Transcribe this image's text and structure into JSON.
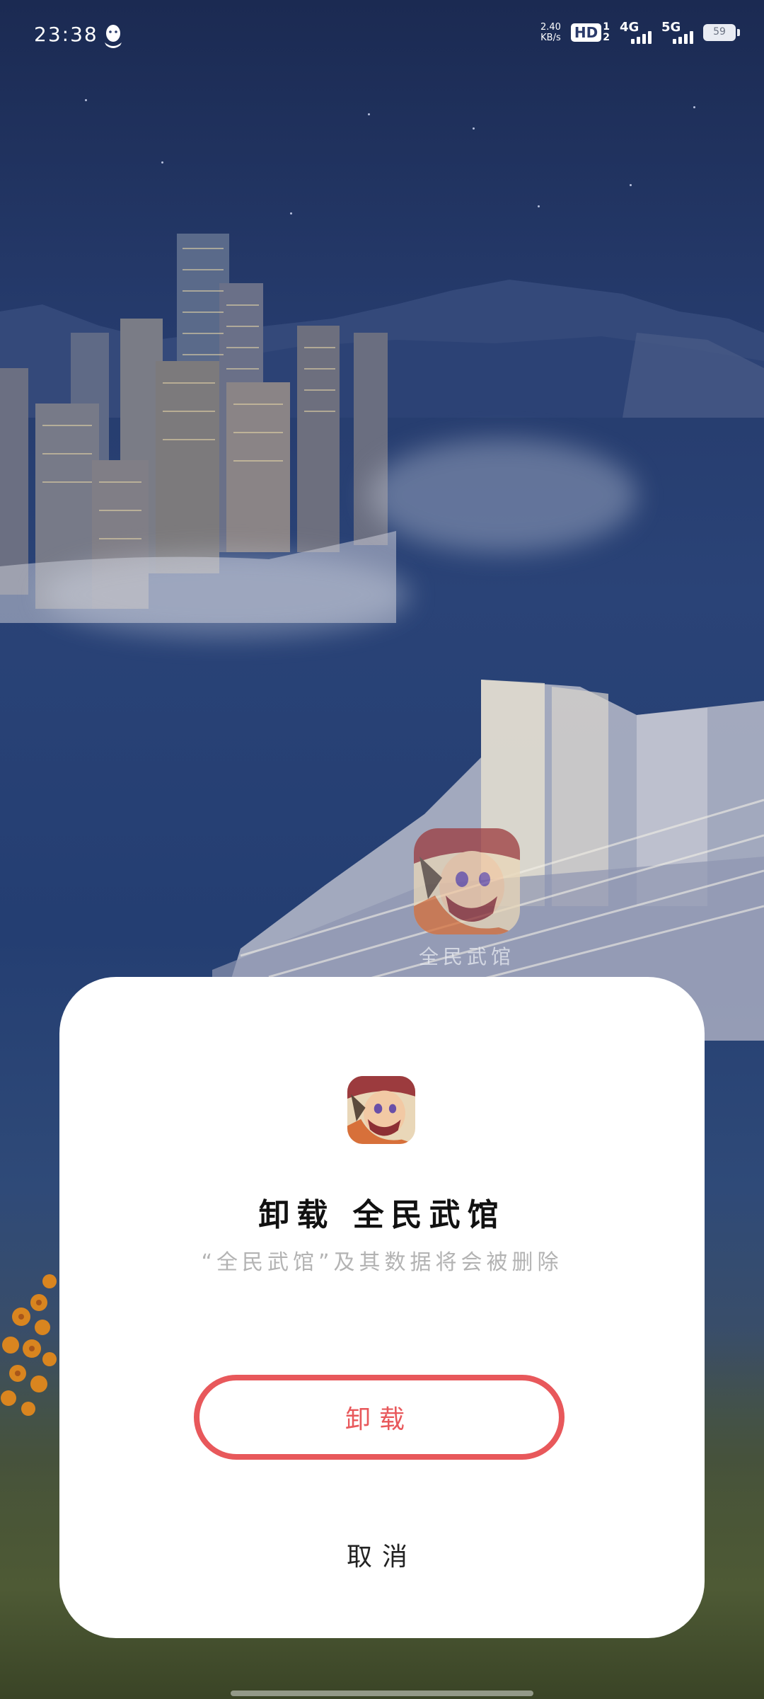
{
  "status_bar": {
    "time": "23:38",
    "net_speed_value": "2.40",
    "net_speed_unit": "KB/s",
    "hd_label": "HD",
    "hd_sub_top": "1",
    "hd_sub_bottom": "2",
    "net1_label": "4G",
    "net2_label": "5G",
    "battery_level": "59",
    "icons": [
      "qq-icon",
      "signal-icon",
      "battery-icon"
    ]
  },
  "desktop": {
    "app_label": "全民武馆",
    "app_icon": "game-avatar-icon"
  },
  "dialog": {
    "app_icon": "game-avatar-icon",
    "title": "卸载 全民武馆",
    "subtitle": "“全民武馆”及其数据将会被删除",
    "confirm_label": "卸载",
    "cancel_label": "取消",
    "accent_color": "#e8585b"
  }
}
